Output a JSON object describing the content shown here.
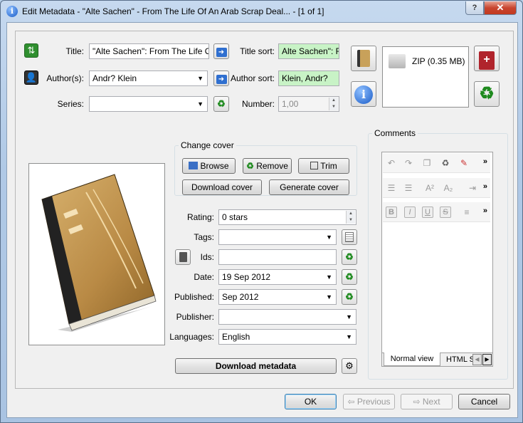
{
  "window": {
    "title": "Edit Metadata - \"Alte Sachen\" - From The Life Of An Arab Scrap Deal...  -  [1 of 1]",
    "help_label": "?",
    "close_label": "✕"
  },
  "top": {
    "title_label": "Title:",
    "title_value": "\"Alte Sachen\": From The Life Of An Arab Scrap Dealer",
    "title_sort_label": "Title sort:",
    "title_sort_value": "Alte Sachen\": From The Life",
    "authors_label": "Author(s):",
    "authors_value": "Andr? Klein",
    "author_sort_label": "Author sort:",
    "author_sort_value": "Klein, Andr?",
    "series_label": "Series:",
    "series_value": "",
    "number_label": "Number:",
    "number_value": "1,00"
  },
  "formats": {
    "item_label": "ZIP (0.35 MB)"
  },
  "cover": {
    "group_title": "Change cover",
    "browse_label": "Browse",
    "remove_label": "Remove",
    "trim_label": "Trim",
    "download_label": "Download cover",
    "generate_label": "Generate cover"
  },
  "fields": {
    "rating_label": "Rating:",
    "rating_value": "0 stars",
    "tags_label": "Tags:",
    "tags_value": "",
    "ids_label": "Ids:",
    "ids_value": "",
    "date_label": "Date:",
    "date_value": "19 Sep 2012",
    "published_label": "Published:",
    "published_value": "Sep 2012",
    "publisher_label": "Publisher:",
    "publisher_value": "",
    "languages_label": "Languages:",
    "languages_value": "English",
    "download_metadata_label": "Download metadata"
  },
  "comments": {
    "title": "Comments",
    "tab_normal": "Normal view",
    "tab_html": "HTML S",
    "more": "»",
    "bold": "B",
    "italic": "I",
    "underline": "U",
    "strike": "S"
  },
  "buttons": {
    "ok": "OK",
    "previous": "Previous",
    "next": "Next",
    "cancel": "Cancel"
  },
  "colors": {
    "green_field": "#c8f3c6",
    "titlebar": "#b0c9e6",
    "close": "#c8452f"
  }
}
